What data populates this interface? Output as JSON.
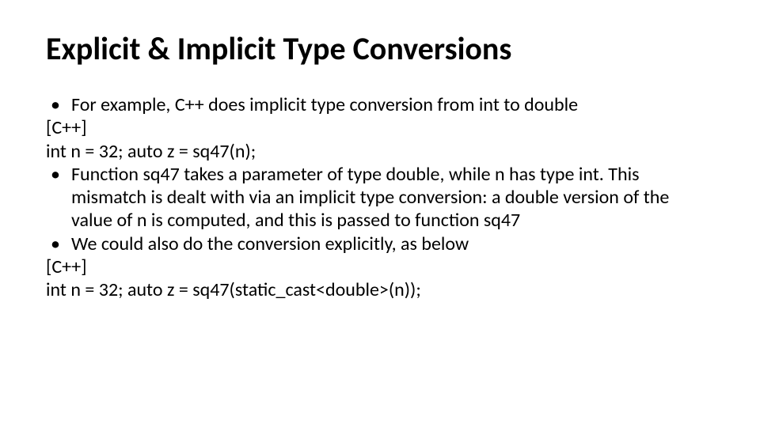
{
  "title": "Explicit & Implicit Type Conversions",
  "lines": {
    "b1": "For example, C++ does implicit type conversion from int to double",
    "l2": "[C++]",
    "l3": "int n = 32;  auto z = sq47(n);",
    "b4": "Function sq47 takes a parameter of type double, while n has type int. This mismatch is dealt with via an implicit type conversion: a double version of the value of n is computed, and this is passed to function sq47",
    "b5": "We could also do the conversion explicitly, as below",
    "l6": "[C++]",
    "l7": "int n = 32; auto z = sq47(static_cast<double>(n));"
  }
}
